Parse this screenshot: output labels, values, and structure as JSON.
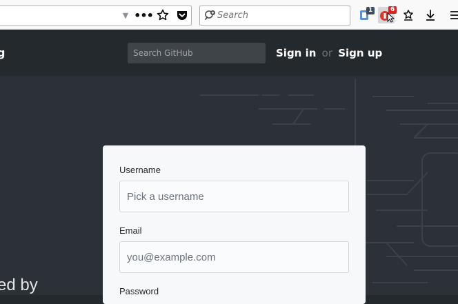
{
  "browser": {
    "search": {
      "placeholder": "Search"
    },
    "extensions": [
      {
        "name": "extension-1",
        "badge": "1"
      },
      {
        "name": "extension-2",
        "badge": "6"
      }
    ]
  },
  "header": {
    "partial_left": "g",
    "search_placeholder": "Search GitHub",
    "sign_in": "Sign in",
    "or": "or",
    "sign_up": "Sign up"
  },
  "hero": {
    "partial_text": "ed by"
  },
  "form": {
    "username_label": "Username",
    "username_placeholder": "Pick a username",
    "email_label": "Email",
    "email_placeholder": "you@example.com",
    "password_label": "Password"
  }
}
